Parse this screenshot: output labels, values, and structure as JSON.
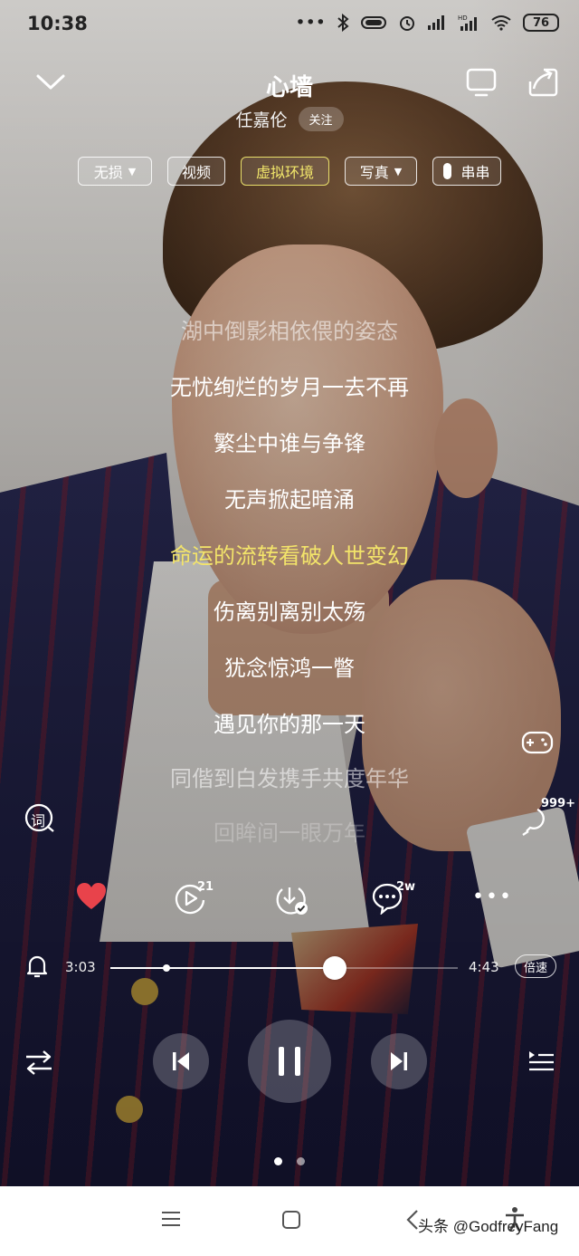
{
  "status_bar": {
    "time": "10:38",
    "battery": "76",
    "icons": [
      "dots-icon",
      "bluetooth-icon",
      "vibrate-icon",
      "alarm-icon",
      "signal-icon",
      "hd-signal-icon",
      "wifi-icon",
      "battery-icon"
    ]
  },
  "header": {
    "title": "心墙",
    "artist": "任嘉伦",
    "follow_label": "关注"
  },
  "chips": [
    {
      "label": "无损",
      "dropdown": true
    },
    {
      "label": "视频",
      "dropdown": false
    },
    {
      "label": "虚拟环境",
      "dropdown": false,
      "active": true
    },
    {
      "label": "写真",
      "dropdown": true
    },
    {
      "label": "串串",
      "dropdown": false
    }
  ],
  "lyrics": {
    "lines": [
      "湖中倒影相依偎的姿态",
      "无忧绚烂的岁月一去不再",
      "繁尘中谁与争锋",
      "无声掀起暗涌",
      "命运的流转看破人世变幻",
      "伤离别离别太殇",
      "犹念惊鸿一瞥",
      "遇见你的那一天",
      "同偕到白发携手共度年华",
      "回眸间一眼万年"
    ],
    "current_index": 4,
    "lyrics_toggle_label": "词"
  },
  "side": {
    "listeners_count": "999+"
  },
  "actions": {
    "play_count": "21",
    "comment_count": "2w"
  },
  "progress": {
    "elapsed": "3:03",
    "total": "4:43",
    "fraction": 0.647,
    "speed_label": "倍速"
  },
  "pager": {
    "pages": 2,
    "current": 0
  },
  "navbar": {
    "watermark": "头条 @GodfreyFang"
  },
  "colors": {
    "accent_lyric": "#f3e46a",
    "like": "#e8434b"
  }
}
